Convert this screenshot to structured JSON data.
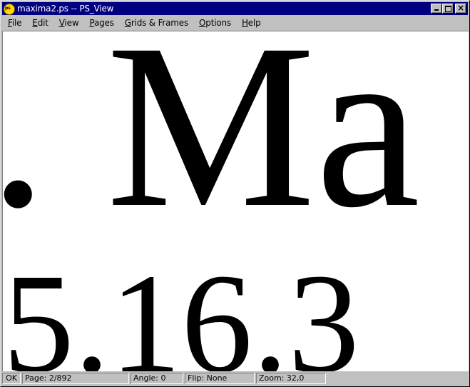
{
  "window": {
    "title": "maxima2.ps -- PS_View",
    "app_icon_text": "ps"
  },
  "menu": {
    "items": [
      {
        "key": "F",
        "rest": "ile"
      },
      {
        "key": "E",
        "rest": "dit"
      },
      {
        "key": "V",
        "rest": "iew"
      },
      {
        "key": "P",
        "rest": "ages"
      },
      {
        "key": "G",
        "rest": "rids & Frames"
      },
      {
        "key": "O",
        "rest": "ptions"
      },
      {
        "key": "H",
        "rest": "elp"
      }
    ]
  },
  "document": {
    "line1": ". Ma",
    "line2": "5.16.3"
  },
  "status": {
    "ok": "OK",
    "page": "Page: 2/892",
    "angle": "Angle: 0",
    "flip": "Flip: None",
    "zoom": "Zoom: 32,0"
  },
  "colors": {
    "titlebar": "#000080",
    "chrome": "#c0c0c0",
    "page": "#ffffff",
    "ink": "#000000"
  }
}
